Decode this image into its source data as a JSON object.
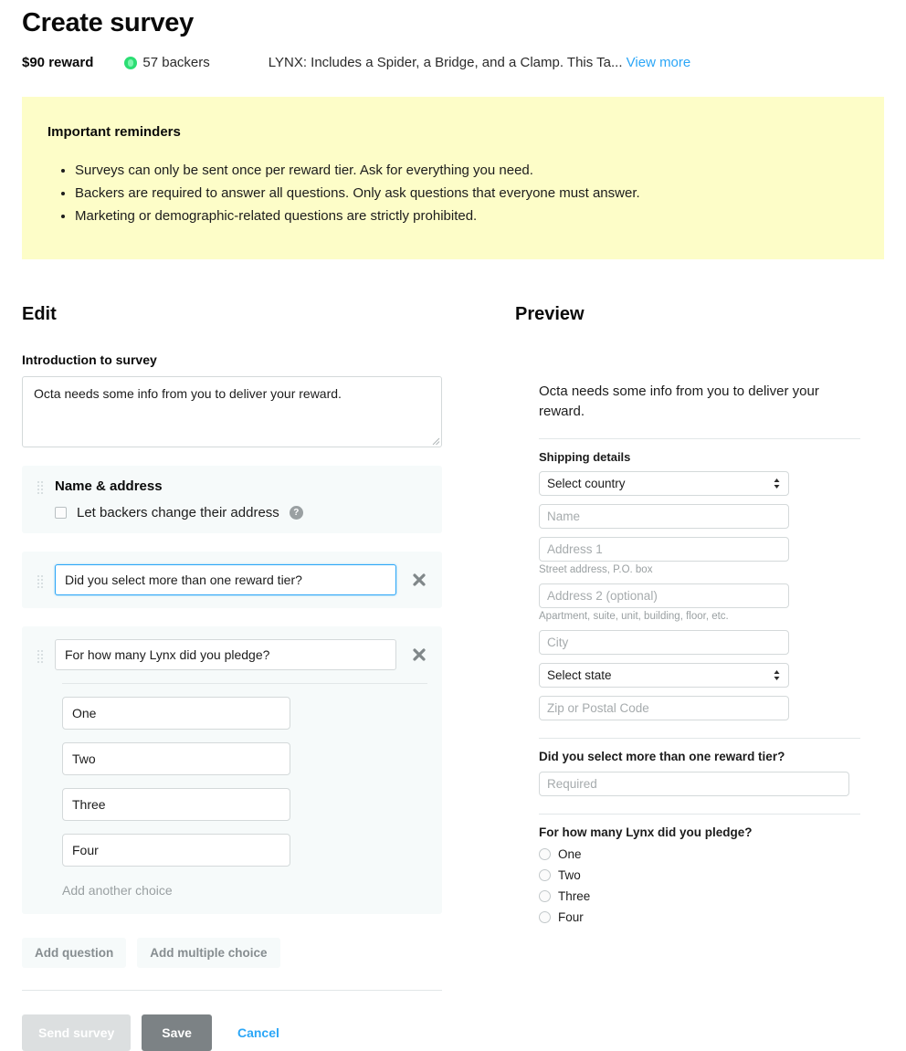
{
  "header": {
    "title": "Create survey",
    "reward_amount": "$90 reward",
    "backers_count": "57 backers",
    "backer_icon": "kickstarter-backer-icon",
    "reward_description": "LYNX: Includes a Spider, a Bridge, and a Clamp. This Ta...",
    "view_more_label": "View more",
    "link_color": "#2BA6F7"
  },
  "reminder": {
    "heading": "Important reminders",
    "background_color": "#FDFDC8",
    "items": [
      "Surveys can only be sent once per reward tier. Ask for everything you need.",
      "Backers are required to answer all questions. Only ask questions that everyone must answer.",
      "Marketing or demographic-related questions are strictly prohibited."
    ]
  },
  "edit": {
    "heading": "Edit",
    "intro_label": "Introduction to survey",
    "intro_value": "Octa needs some info from you to deliver your reward.",
    "name_address": {
      "title": "Name & address",
      "checkbox_label": "Let backers change their address",
      "checkbox_checked": false,
      "help_icon": "help-circle-icon"
    },
    "questions": [
      {
        "value": "Did you select more than one reward tier?",
        "focused": true,
        "type": "text"
      },
      {
        "value": "For how many Lynx did you pledge?",
        "focused": false,
        "type": "multiple-choice",
        "choices": [
          "One",
          "Two",
          "Three",
          "Four"
        ],
        "add_choice_label": "Add another choice"
      }
    ],
    "add_question_label": "Add question",
    "add_multiple_choice_label": "Add multiple choice",
    "send_survey_label": "Send survey",
    "save_label": "Save",
    "cancel_label": "Cancel",
    "save_button_color": "#7C8285",
    "send_button_color": "#DCDFE0"
  },
  "preview": {
    "heading": "Preview",
    "intro_text": "Octa needs some info from you to deliver your reward.",
    "shipping_label": "Shipping details",
    "country_select_value": "Select country",
    "fields": [
      {
        "placeholder": "Name",
        "hint": ""
      },
      {
        "placeholder": "Address 1",
        "hint": "Street address, P.O. box"
      },
      {
        "placeholder": "Address 2 (optional)",
        "hint": "Apartment, suite, unit, building, floor, etc."
      },
      {
        "placeholder": "City",
        "hint": ""
      }
    ],
    "state_select_value": "Select state",
    "zip_placeholder": "Zip or Postal Code",
    "question_1": {
      "title": "Did you select more than one reward tier?",
      "input_placeholder": "Required"
    },
    "question_2": {
      "title": "For how many Lynx did you pledge?",
      "options": [
        "One",
        "Two",
        "Three",
        "Four"
      ]
    }
  }
}
